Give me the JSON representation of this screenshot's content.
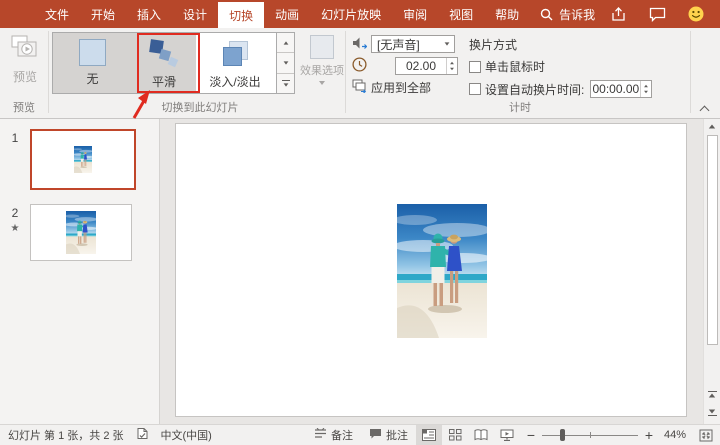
{
  "titlebar": {
    "tabs": [
      {
        "label": "文件"
      },
      {
        "label": "开始"
      },
      {
        "label": "插入"
      },
      {
        "label": "设计"
      },
      {
        "label": "切换",
        "active": true
      },
      {
        "label": "动画"
      },
      {
        "label": "幻灯片放映"
      },
      {
        "label": "审阅"
      },
      {
        "label": "视图"
      },
      {
        "label": "帮助"
      }
    ],
    "tell_me_label": "告诉我"
  },
  "ribbon": {
    "preview_group": {
      "button_label": "预览",
      "group_label": "预览"
    },
    "transition_group": {
      "items": [
        {
          "label": "无",
          "selected": true
        },
        {
          "label": "平滑",
          "annotated": true
        },
        {
          "label": "淡入/淡出"
        }
      ],
      "effect_options_label": "效果选项",
      "group_label": "切换到此幻灯片"
    },
    "timing_group": {
      "sound_value": "[无声音]",
      "duration_value": "02.00",
      "apply_to_all_label": "应用到全部",
      "advance_heading": "换片方式",
      "on_mouse_click_label": "单击鼠标时",
      "on_mouse_click_checked": false,
      "auto_advance_label": "设置自动换片时间:",
      "auto_advance_value": "00:00.00",
      "auto_advance_checked": false,
      "group_label": "计时"
    }
  },
  "slide_panel": {
    "slides": [
      {
        "number": "1",
        "selected": true,
        "transition_marker": ""
      },
      {
        "number": "2",
        "selected": false,
        "transition_marker": "★"
      }
    ]
  },
  "statusbar": {
    "slide_info": "幻灯片 第 1 张，共 2 张",
    "language": "中文(中国)",
    "notes_label": "备注",
    "comments_label": "批注",
    "zoom_value": "44%"
  },
  "colors": {
    "accent": "#B7472A",
    "annotation_red": "#E02B20",
    "gallery_selected_bg": "#D5D3D1"
  }
}
